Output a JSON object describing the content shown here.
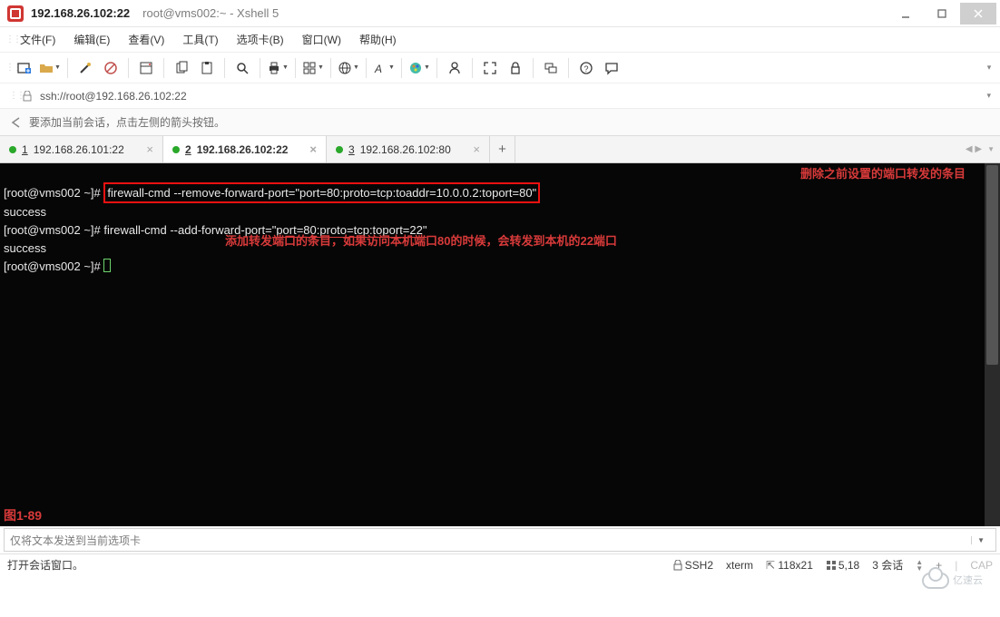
{
  "titlebar": {
    "primary": "192.168.26.102:22",
    "secondary": "root@vms002:~ - Xshell 5"
  },
  "menu": {
    "file": "文件(F)",
    "edit": "编辑(E)",
    "view": "查看(V)",
    "tools": "工具(T)",
    "tabs": "选项卡(B)",
    "window": "窗口(W)",
    "help": "帮助(H)"
  },
  "address": "ssh://root@192.168.26.102:22",
  "hint": "要添加当前会话，点击左侧的箭头按钮。",
  "tabs": [
    {
      "num": "1",
      "label": "192.168.26.101:22"
    },
    {
      "num": "2",
      "label": "192.168.26.102:22"
    },
    {
      "num": "3",
      "label": "192.168.26.102:80"
    }
  ],
  "term": {
    "prompt1": "[root@vms002 ~]# ",
    "cmd1": "firewall-cmd --remove-forward-port=\"port=80:proto=tcp:toaddr=10.0.0.2:toport=80\"",
    "out1": "success",
    "prompt2": "[root@vms002 ~]# ",
    "cmd2a": "firewall-cmd --add-forward-port=",
    "cmd2b": "\"port=80:proto=tcp:toport=22\"",
    "out2": "success",
    "prompt3": "[root@vms002 ~]# ",
    "annot_right": "删除之前设置的端口转发的条目",
    "annot_below": "添加转发端口的条目，如果访问本机端口80的时候，会转发到本机的22端口",
    "figlabel": "图1-89"
  },
  "inputbar": {
    "placeholder": "仅将文本发送到当前选项卡"
  },
  "status": {
    "left": "打开会话窗口。",
    "ssh": "SSH2",
    "term": "xterm",
    "size": "118x21",
    "pos": "5,18",
    "sessions": "3 会话",
    "cap": "CAP"
  },
  "watermark": "亿速云"
}
